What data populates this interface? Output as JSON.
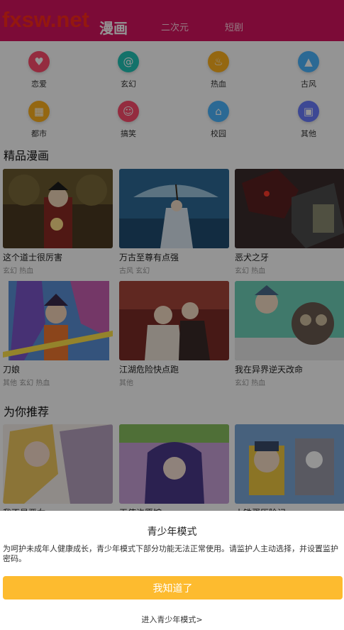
{
  "header": {
    "brand": "fxsw.net",
    "tabs": [
      {
        "label": "漫画",
        "active": true
      },
      {
        "label": "二次元",
        "active": false
      },
      {
        "label": "短剧",
        "active": false
      }
    ]
  },
  "categories": [
    {
      "label": "恋爱",
      "icon": "heart-icon",
      "color": "#ff4d6d"
    },
    {
      "label": "玄幻",
      "icon": "swirl-icon",
      "color": "#21c4b7"
    },
    {
      "label": "热血",
      "icon": "flame-icon",
      "color": "#ffb21e"
    },
    {
      "label": "古风",
      "icon": "mountain-icon",
      "color": "#4bb6ff"
    },
    {
      "label": "都市",
      "icon": "building-icon",
      "color": "#ffb21e"
    },
    {
      "label": "搞笑",
      "icon": "smile-icon",
      "color": "#ff4d6d"
    },
    {
      "label": "校园",
      "icon": "school-icon",
      "color": "#4bb6ff"
    },
    {
      "label": "其他",
      "icon": "grid-icon",
      "color": "#6a7cff"
    }
  ],
  "sections": {
    "featured": "精品漫画",
    "recommended": "为你推荐"
  },
  "featured": [
    {
      "title": "这个道士很厉害",
      "tags": "玄幻 热血"
    },
    {
      "title": "万古至尊有点强",
      "tags": "古风 玄幻"
    },
    {
      "title": "恶犬之牙",
      "tags": "玄幻 热血"
    },
    {
      "title": "刀娘",
      "tags": "其他 玄幻 热血"
    },
    {
      "title": "江湖危险快点跑",
      "tags": "其他"
    },
    {
      "title": "我在异界逆天改命",
      "tags": "玄幻 热血"
    }
  ],
  "recommended": [
    {
      "title": "我不是恶女"
    },
    {
      "title": "天使许愿馆"
    },
    {
      "title": "小铁蛋历险记"
    }
  ],
  "teen_mode": {
    "title": "青少年模式",
    "description": "为呵护未成年人健康成长，青少年模式下部分功能无法正常使用。请监护人主动选择，并设置监护密码。",
    "confirm_label": "我知道了",
    "enter_link": "进入青少年模式>"
  },
  "colors": {
    "header_bg": "#d6145f",
    "brand_text": "#ff2a1a",
    "confirm_button": "#fdbb2f"
  }
}
